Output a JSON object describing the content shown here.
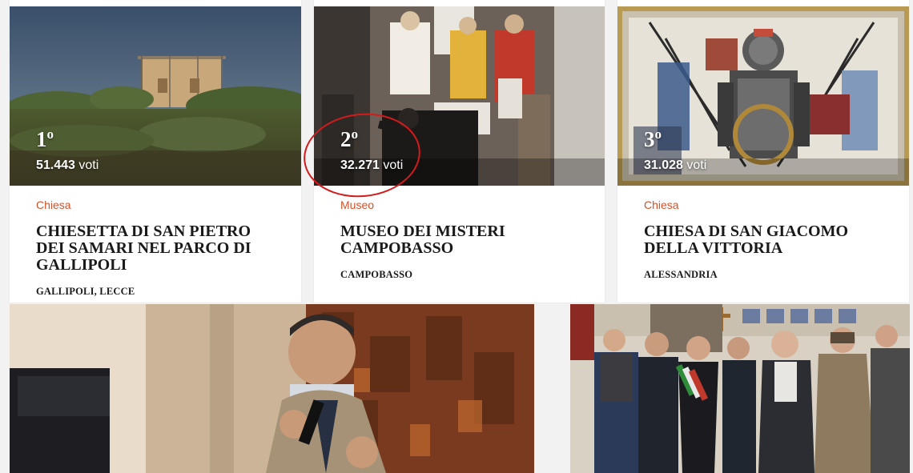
{
  "cards": [
    {
      "rank_number": "1",
      "rank_suffix": "o",
      "votes_count": "51.443",
      "votes_unit": "voti",
      "category": "Chiesa",
      "title": "Chiesetta di San Pietro dei Samari nel Parco di Gallipoli",
      "location": "Gallipoli, Lecce"
    },
    {
      "rank_number": "2",
      "rank_suffix": "o",
      "votes_count": "32.271",
      "votes_unit": "voti",
      "category": "Museo",
      "title": "Museo dei Misteri Campobasso",
      "location": "Campobasso"
    },
    {
      "rank_number": "3",
      "rank_suffix": "o",
      "votes_count": "31.028",
      "votes_unit": "voti",
      "category": "Chiesa",
      "title": "Chiesa di San Giacomo della Vittoria",
      "location": "Alessandria"
    }
  ],
  "colors": {
    "category": "#d2532c",
    "annotation_circle": "#d41b1b"
  }
}
